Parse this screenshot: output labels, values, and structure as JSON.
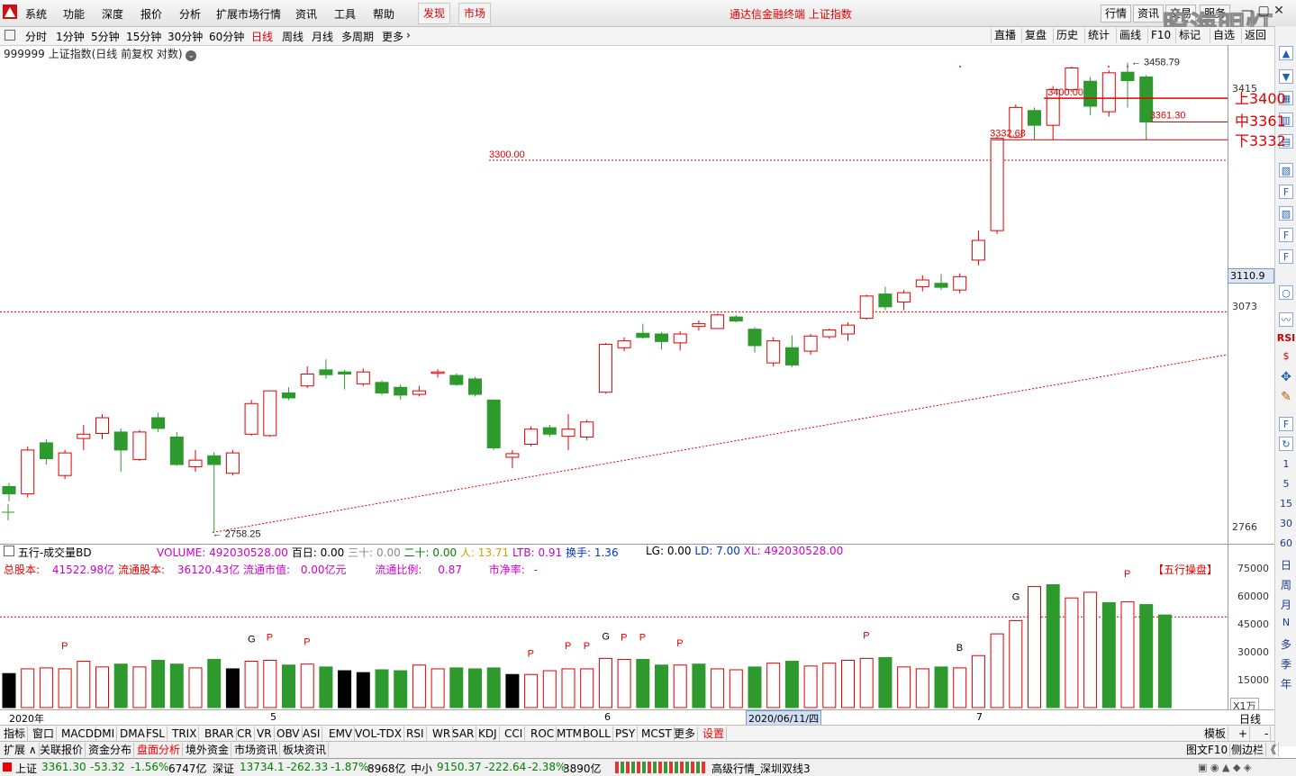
{
  "menubar": {
    "items": [
      "系统",
      "功能",
      "深度",
      "报价",
      "分析",
      "扩展市场行情",
      "资讯",
      "工具",
      "帮助"
    ],
    "tabs": [
      "发现",
      "市场"
    ],
    "title": "通达信金融终端 上证指数",
    "right_buttons": [
      "行情",
      "资讯",
      "交易",
      "服务"
    ],
    "watermark": "股海明灯"
  },
  "periodbar": {
    "periods": [
      "分时",
      "1分钟",
      "5分钟",
      "15分钟",
      "30分钟",
      "60分钟",
      "日线",
      "周线",
      "月线",
      "多周期",
      "更多"
    ],
    "active": "日线",
    "tools": [
      "直播",
      "复盘",
      "历史",
      "统计",
      "画线",
      "F10",
      "标记",
      "自选",
      "返回"
    ]
  },
  "chart": {
    "header": "999999 上证指数(日线 前复权 对数)",
    "labels": {
      "low": "2758.25",
      "high": "3458.79",
      "line3300": "3300.00",
      "line3400": "3400.00",
      "val3361": "3361.30",
      "val3332": "3332.68",
      "current": "3110.9"
    },
    "yticks": [
      "3415",
      "3073",
      "2766"
    ],
    "annotations": [
      "上3400",
      "中3361",
      "下3332"
    ],
    "colors": {
      "up": "#e00000",
      "down": "#2e9a2e"
    },
    "candles": [
      {
        "o": 2820,
        "c": 2810,
        "h": 2825,
        "l": 2800
      },
      {
        "o": 2810,
        "c": 2870,
        "h": 2875,
        "l": 2805
      },
      {
        "o": 2880,
        "c": 2858,
        "h": 2885,
        "l": 2850
      },
      {
        "o": 2835,
        "c": 2866,
        "h": 2870,
        "l": 2830
      },
      {
        "o": 2886,
        "c": 2892,
        "h": 2905,
        "l": 2870
      },
      {
        "o": 2893,
        "c": 2915,
        "h": 2920,
        "l": 2885
      },
      {
        "o": 2895,
        "c": 2870,
        "h": 2900,
        "l": 2840
      },
      {
        "o": 2857,
        "c": 2895,
        "h": 2898,
        "l": 2855
      },
      {
        "o": 2915,
        "c": 2900,
        "h": 2922,
        "l": 2895
      },
      {
        "o": 2888,
        "c": 2850,
        "h": 2895,
        "l": 2848
      },
      {
        "o": 2847,
        "c": 2856,
        "h": 2870,
        "l": 2840
      },
      {
        "o": 2862,
        "c": 2850,
        "h": 2867,
        "l": 2758.25
      },
      {
        "o": 2838,
        "c": 2866,
        "h": 2870,
        "l": 2835
      },
      {
        "o": 2892,
        "c": 2935,
        "h": 2940,
        "l": 2890
      },
      {
        "o": 2890,
        "c": 2953,
        "h": 2953,
        "l": 2888
      },
      {
        "o": 2950,
        "c": 2943,
        "h": 2958,
        "l": 2940
      },
      {
        "o": 2960,
        "c": 2977,
        "h": 2988,
        "l": 2957
      },
      {
        "o": 2983,
        "c": 2976,
        "h": 2998,
        "l": 2970
      },
      {
        "o": 2980,
        "c": 2977,
        "h": 2983,
        "l": 2955
      },
      {
        "o": 2963,
        "c": 2980,
        "h": 2985,
        "l": 2960
      },
      {
        "o": 2965,
        "c": 2950,
        "h": 2968,
        "l": 2947
      },
      {
        "o": 2958,
        "c": 2947,
        "h": 2962,
        "l": 2940
      },
      {
        "o": 2948,
        "c": 2953,
        "h": 2960,
        "l": 2945
      },
      {
        "o": 2978,
        "c": 2980,
        "h": 2984,
        "l": 2972
      },
      {
        "o": 2975,
        "c": 2962,
        "h": 2978,
        "l": 2960
      },
      {
        "o": 2970,
        "c": 2948,
        "h": 2973,
        "l": 2945
      },
      {
        "o": 2940,
        "c": 2873,
        "h": 2940,
        "l": 2870
      },
      {
        "o": 2860,
        "c": 2865,
        "h": 2870,
        "l": 2845
      },
      {
        "o": 2878,
        "c": 2899,
        "h": 2903,
        "l": 2875
      },
      {
        "o": 2901,
        "c": 2892,
        "h": 2905,
        "l": 2888
      },
      {
        "o": 2889,
        "c": 2899,
        "h": 2920,
        "l": 2870
      },
      {
        "o": 2888,
        "c": 2909,
        "h": 2912,
        "l": 2884
      },
      {
        "o": 2951,
        "c": 3020,
        "h": 3022,
        "l": 2949
      },
      {
        "o": 3015,
        "c": 3025,
        "h": 3030,
        "l": 3010
      },
      {
        "o": 3036,
        "c": 3030,
        "h": 3050,
        "l": 3028
      },
      {
        "o": 3035,
        "c": 3024,
        "h": 3038,
        "l": 3012
      },
      {
        "o": 3022,
        "c": 3035,
        "h": 3039,
        "l": 3011
      },
      {
        "o": 3046,
        "c": 3050,
        "h": 3055,
        "l": 3040
      },
      {
        "o": 3043,
        "c": 3063,
        "h": 3065,
        "l": 3043
      },
      {
        "o": 3060,
        "c": 3054,
        "h": 3063,
        "l": 3052
      },
      {
        "o": 3042,
        "c": 3018,
        "h": 3045,
        "l": 3008
      },
      {
        "o": 2993,
        "c": 3025,
        "h": 3030,
        "l": 2988
      },
      {
        "o": 3015,
        "c": 2990,
        "h": 3033,
        "l": 2987
      },
      {
        "o": 3010,
        "c": 3032,
        "h": 3035,
        "l": 3005
      },
      {
        "o": 3031,
        "c": 3041,
        "h": 3043,
        "l": 3028
      },
      {
        "o": 3035,
        "c": 3048,
        "h": 3052,
        "l": 3025
      },
      {
        "o": 3058,
        "c": 3091,
        "h": 3093,
        "l": 3056
      },
      {
        "o": 3094,
        "c": 3075,
        "h": 3105,
        "l": 3070
      },
      {
        "o": 3082,
        "c": 3096,
        "h": 3100,
        "l": 3070
      },
      {
        "o": 3105,
        "c": 3115,
        "h": 3122,
        "l": 3098
      },
      {
        "o": 3110,
        "c": 3104,
        "h": 3124,
        "l": 3100
      },
      {
        "o": 3100,
        "c": 3120,
        "h": 3125,
        "l": 3095
      },
      {
        "o": 3145,
        "c": 3175,
        "h": 3190,
        "l": 3137
      },
      {
        "o": 3190,
        "c": 3335,
        "h": 3338,
        "l": 3185
      },
      {
        "o": 3337,
        "c": 3385,
        "h": 3390,
        "l": 3335
      },
      {
        "o": 3380,
        "c": 3356,
        "h": 3385,
        "l": 3333
      },
      {
        "o": 3356,
        "c": 3414,
        "h": 3420,
        "l": 3332.68
      },
      {
        "o": 3414,
        "c": 3450,
        "h": 3452,
        "l": 3410
      },
      {
        "o": 3428,
        "c": 3387,
        "h": 3435,
        "l": 3372
      },
      {
        "o": 3378,
        "c": 3442,
        "h": 3446,
        "l": 3370
      },
      {
        "o": 3443,
        "c": 3429,
        "h": 3458.79,
        "l": 3385
      },
      {
        "o": 3435,
        "c": 3361.3,
        "h": 3438,
        "l": 3332
      }
    ]
  },
  "volume": {
    "header": "五行-成交量BD",
    "volume_label": "VOLUME: 492030528.00",
    "baishi": "百日: 0.00",
    "sanshi": "三十: 0.00",
    "ershi": "二十: 0.00",
    "ren": "人: 13.71",
    "ltb": "LTB: 0.91",
    "huanshou": "换手: 1.36",
    "lg": "LG: 0.00",
    "ld": "LD: 7.00",
    "xl": "XL: 492030528.00",
    "zongguben": "总股本:",
    "zongguben_val": "41522.98亿",
    "liutong": "流通股本:",
    "liutong_val": "36120.43亿",
    "liutongshizhi": "流通市值:",
    "liutongshizhi_val": "0.00亿元",
    "liutongbili": "流通比例:",
    "liutongbili_val": "0.87",
    "shijinglv": "市净率:",
    "shijinglv_val": "-",
    "wuxing": "【五行操盘】",
    "yticks": [
      "75000",
      "60000",
      "45000",
      "30000",
      "15000"
    ],
    "unit": "X1万",
    "bars": [
      {
        "v": 18000,
        "c": "k"
      },
      {
        "v": 20500,
        "c": "r"
      },
      {
        "v": 21000,
        "c": "r"
      },
      {
        "v": 20500,
        "c": "r"
      },
      {
        "v": 24500,
        "c": "r"
      },
      {
        "v": 21500,
        "c": "r"
      },
      {
        "v": 23000,
        "c": "g"
      },
      {
        "v": 21500,
        "c": "r"
      },
      {
        "v": 25000,
        "c": "g"
      },
      {
        "v": 23000,
        "c": "g"
      },
      {
        "v": 21000,
        "c": "r"
      },
      {
        "v": 25500,
        "c": "g"
      },
      {
        "v": 20500,
        "c": "k"
      },
      {
        "v": 24500,
        "c": "r"
      },
      {
        "v": 25000,
        "c": "r"
      },
      {
        "v": 22500,
        "c": "g"
      },
      {
        "v": 23000,
        "c": "r"
      },
      {
        "v": 21500,
        "c": "g"
      },
      {
        "v": 19500,
        "c": "k"
      },
      {
        "v": 18500,
        "c": "k"
      },
      {
        "v": 20000,
        "c": "g"
      },
      {
        "v": 19500,
        "c": "g"
      },
      {
        "v": 22500,
        "c": "r"
      },
      {
        "v": 20500,
        "c": "r"
      },
      {
        "v": 21000,
        "c": "g"
      },
      {
        "v": 20500,
        "c": "g"
      },
      {
        "v": 21000,
        "c": "g"
      },
      {
        "v": 17500,
        "c": "k"
      },
      {
        "v": 17500,
        "c": "r"
      },
      {
        "v": 19500,
        "c": "r"
      },
      {
        "v": 20500,
        "c": "r"
      },
      {
        "v": 20500,
        "c": "r"
      },
      {
        "v": 26000,
        "c": "r"
      },
      {
        "v": 25500,
        "c": "r"
      },
      {
        "v": 25500,
        "c": "g"
      },
      {
        "v": 22500,
        "c": "g"
      },
      {
        "v": 22500,
        "c": "r"
      },
      {
        "v": 23000,
        "c": "g"
      },
      {
        "v": 20500,
        "c": "r"
      },
      {
        "v": 20000,
        "c": "r"
      },
      {
        "v": 21500,
        "c": "g"
      },
      {
        "v": 23500,
        "c": "r"
      },
      {
        "v": 24500,
        "c": "g"
      },
      {
        "v": 22000,
        "c": "r"
      },
      {
        "v": 23500,
        "c": "r"
      },
      {
        "v": 25000,
        "c": "r"
      },
      {
        "v": 26000,
        "c": "r"
      },
      {
        "v": 26500,
        "c": "g"
      },
      {
        "v": 21500,
        "c": "r"
      },
      {
        "v": 20500,
        "c": "r"
      },
      {
        "v": 21500,
        "c": "g"
      },
      {
        "v": 21000,
        "c": "r"
      },
      {
        "v": 27500,
        "c": "r"
      },
      {
        "v": 39000,
        "c": "r"
      },
      {
        "v": 46000,
        "c": "r"
      },
      {
        "v": 64000,
        "c": "r"
      },
      {
        "v": 65000,
        "c": "g"
      },
      {
        "v": 58000,
        "c": "r"
      },
      {
        "v": 61000,
        "c": "r"
      },
      {
        "v": 55500,
        "c": "g"
      },
      {
        "v": 56000,
        "c": "r"
      },
      {
        "v": 54500,
        "c": "g"
      },
      {
        "v": 49000,
        "c": "g"
      }
    ],
    "marks": [
      {
        "i": 3,
        "t": "P",
        "v": 31000
      },
      {
        "i": 13,
        "t": "G",
        "v": 34500
      },
      {
        "i": 14,
        "t": "P",
        "v": 35500
      },
      {
        "i": 16,
        "t": "P",
        "v": 33000
      },
      {
        "i": 28,
        "t": "P",
        "v": 27000
      },
      {
        "i": 30,
        "t": "P",
        "v": 31000
      },
      {
        "i": 31,
        "t": "P",
        "v": 31000
      },
      {
        "i": 32,
        "t": "G",
        "v": 36000
      },
      {
        "i": 33,
        "t": "P",
        "v": 35500
      },
      {
        "i": 34,
        "t": "P",
        "v": 35500
      },
      {
        "i": 36,
        "t": "P",
        "v": 32500
      },
      {
        "i": 46,
        "t": "P",
        "v": 36500
      },
      {
        "i": 51,
        "t": "B",
        "v": 30000
      },
      {
        "i": 54,
        "t": "G",
        "v": 57000
      },
      {
        "i": 60,
        "t": "P",
        "v": 69000
      }
    ]
  },
  "axis_dates": [
    "2020年",
    "5",
    "6",
    "2020/06/11/四",
    "7"
  ],
  "axis_period": "日线",
  "indicators": [
    "指标",
    "窗口",
    "MACD",
    "DMI",
    "DMA",
    "FSL",
    "TRIX",
    "BRAR",
    "CR",
    "VR",
    "OBV",
    "ASI",
    "EMV",
    "VOL-TDX",
    "RSI",
    "WR",
    "SAR",
    "KDJ",
    "CCI",
    "ROC",
    "MTM",
    "BOLL",
    "PSY",
    "MCST",
    "更多",
    "设置"
  ],
  "ind_right": [
    "模板",
    "+",
    "-"
  ],
  "funcs": [
    "扩展",
    "关联报价",
    "资金分布",
    "盘面分析",
    "境外资金",
    "市场资讯",
    "板块资讯"
  ],
  "func_right": [
    "图文F10",
    "侧边栏",
    "《"
  ],
  "status": {
    "sh_name": "上证",
    "sh_price": "3361.30",
    "sh_chg": "-53.32",
    "sh_pct": "-1.56%",
    "sh_amt": "6747亿",
    "sz_name": "深证",
    "sz_price": "13734.1",
    "sz_chg": "-262.33",
    "sz_pct": "-1.87%",
    "sz_amt": "8968亿",
    "zx_name": "中小",
    "zx_price": "9150.37",
    "zx_chg": "-222.64",
    "zx_pct": "-2.38%",
    "zx_amt": "3890亿",
    "source": "高级行情_深圳双线3"
  },
  "righttool": {
    "chars": [
      "1",
      "5",
      "15",
      "30",
      "60",
      "日",
      "周",
      "月",
      "N",
      "多",
      "季",
      "年"
    ]
  }
}
